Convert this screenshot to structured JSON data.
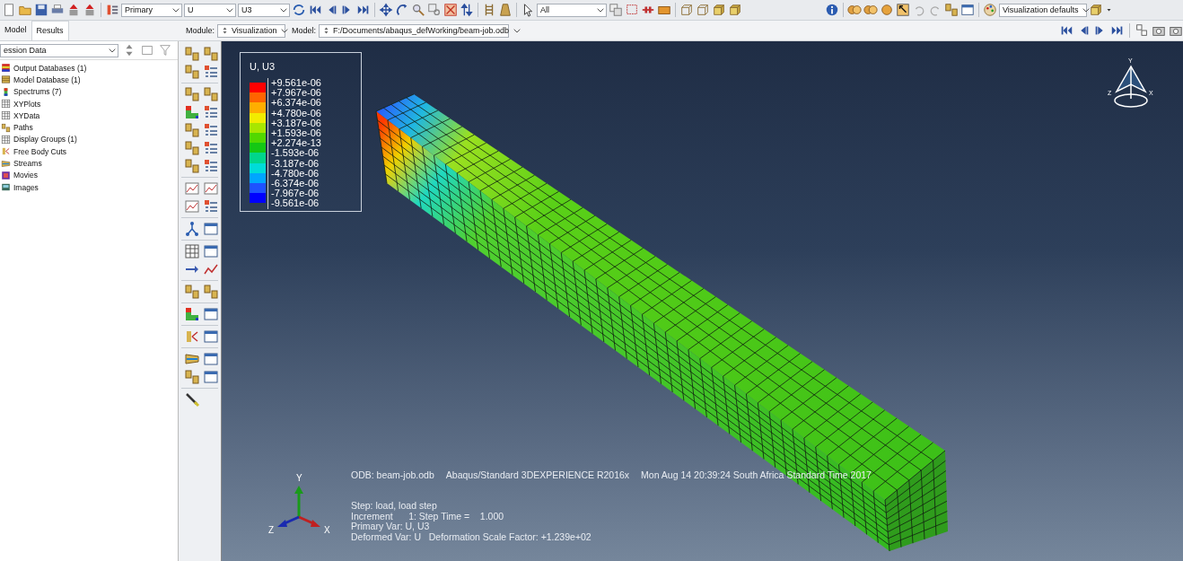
{
  "toolbar": {
    "primary_select": "Primary",
    "variable_select": "U",
    "component_select": "U3",
    "filter_select": "All",
    "defaults_select": "Visualization defaults"
  },
  "tabs": [
    {
      "label": "Model",
      "selected": false
    },
    {
      "label": "Results",
      "selected": true
    }
  ],
  "module": {
    "label": "Module:",
    "value": "Visualization"
  },
  "model": {
    "label": "Model:",
    "value": "F:/Documents/abaqus_defWorking/beam-job.odb"
  },
  "session_select": "ession Data",
  "tree": [
    {
      "label": "Output Databases (1)"
    },
    {
      "label": "Model Database (1)"
    },
    {
      "label": "Spectrums (7)"
    },
    {
      "label": "XYPlots"
    },
    {
      "label": "XYData"
    },
    {
      "label": "Paths"
    },
    {
      "label": "Display Groups (1)"
    },
    {
      "label": "Free Body Cuts"
    },
    {
      "label": "Streams"
    },
    {
      "label": "Movies"
    },
    {
      "label": "Images"
    }
  ],
  "legend": {
    "title": "U, U3",
    "bands": [
      {
        "color": "#ff0000"
      },
      {
        "color": "#ff6400"
      },
      {
        "color": "#ffae00"
      },
      {
        "color": "#f2ec00"
      },
      {
        "color": "#a8e600"
      },
      {
        "color": "#52d800"
      },
      {
        "color": "#14c814"
      },
      {
        "color": "#00d68c"
      },
      {
        "color": "#00dcd8"
      },
      {
        "color": "#00a6ff"
      },
      {
        "color": "#1e52ff"
      },
      {
        "color": "#0000ff"
      }
    ],
    "labels": [
      "+9.561e-06",
      "+7.967e-06",
      "+6.374e-06",
      "+4.780e-06",
      "+3.187e-06",
      "+1.593e-06",
      "+2.274e-13",
      "-1.593e-06",
      "-3.187e-06",
      "-4.780e-06",
      "-6.374e-06",
      "-7.967e-06",
      "-9.561e-06"
    ]
  },
  "view_axes": {
    "y": "Y",
    "z": "Z",
    "x": "X"
  },
  "info": {
    "header": [
      "ODB: beam-job.odb",
      "Abaqus/Standard 3DEXPERIENCE R2016x",
      "Mon Aug 14 20:39:24 South Africa Standard Time 2017"
    ],
    "lines": [
      "Step: load, load step",
      "Increment      1: Step Time =    1.000",
      "Primary Var: U, U3",
      "Deformed Var: U   Deformation Scale Factor: +1.239e+02"
    ]
  },
  "triad": {
    "y": "Y",
    "z": "Z",
    "x": "X"
  }
}
